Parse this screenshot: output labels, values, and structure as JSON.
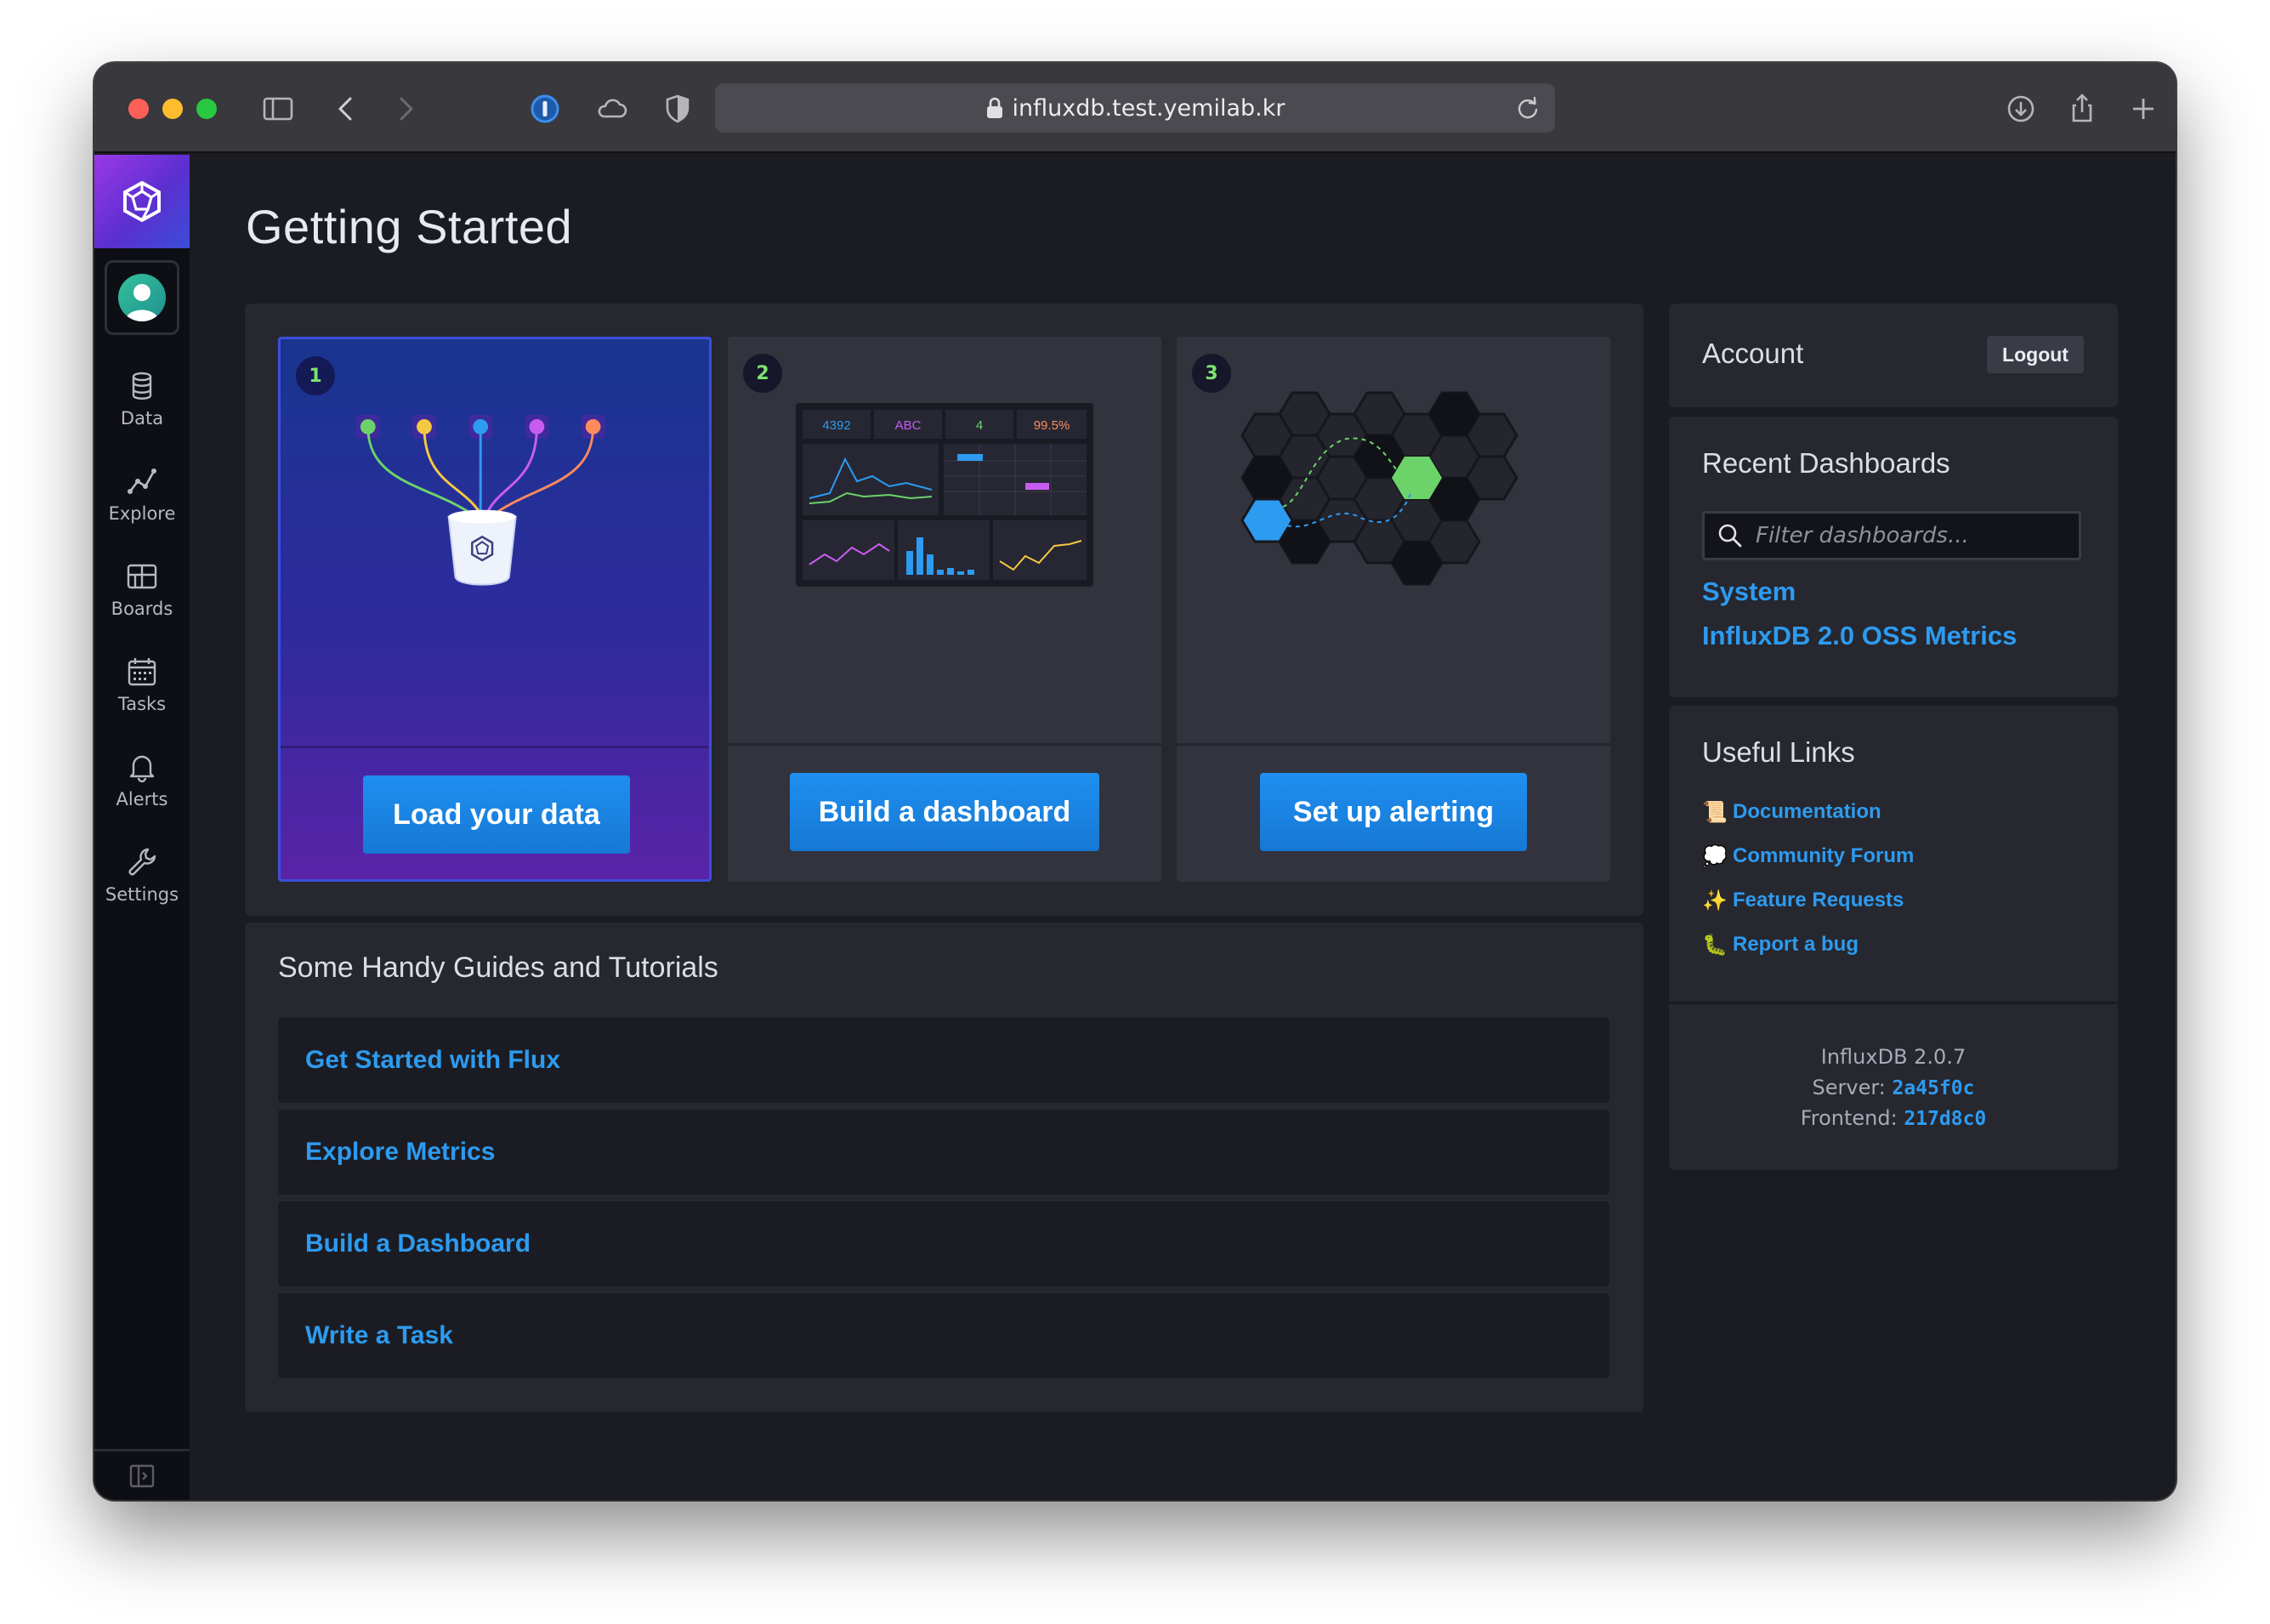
{
  "browser": {
    "url": "influxdb.test.yemilab.kr"
  },
  "sidebar": {
    "items": [
      {
        "label": "Data",
        "icon": "database-icon"
      },
      {
        "label": "Explore",
        "icon": "graph-icon"
      },
      {
        "label": "Boards",
        "icon": "grid-icon"
      },
      {
        "label": "Tasks",
        "icon": "calendar-icon"
      },
      {
        "label": "Alerts",
        "icon": "bell-icon"
      },
      {
        "label": "Settings",
        "icon": "wrench-icon"
      }
    ]
  },
  "main": {
    "title": "Getting Started",
    "steps": [
      {
        "number": "1",
        "button": "Load your data"
      },
      {
        "number": "2",
        "button": "Build a dashboard"
      },
      {
        "number": "3",
        "button": "Set up alerting"
      }
    ],
    "dashboard_illustration": {
      "stats": [
        "4392",
        "ABC",
        "4",
        "99.5%"
      ]
    },
    "guides": {
      "title": "Some Handy Guides and Tutorials",
      "items": [
        "Get Started with Flux",
        "Explore Metrics",
        "Build a Dashboard",
        "Write a Task"
      ]
    }
  },
  "account": {
    "title": "Account",
    "logout": "Logout"
  },
  "recent_dashboards": {
    "title": "Recent Dashboards",
    "filter_placeholder": "Filter dashboards...",
    "items": [
      "System",
      "InfluxDB 2.0 OSS Metrics"
    ]
  },
  "useful_links": {
    "title": "Useful Links",
    "items": [
      {
        "emoji": "📜",
        "label": "Documentation"
      },
      {
        "emoji": "💭",
        "label": "Community Forum"
      },
      {
        "emoji": "✨",
        "label": "Feature Requests"
      },
      {
        "emoji": "🐛",
        "label": "Report a bug"
      }
    ]
  },
  "version": {
    "product": "InfluxDB 2.0.7",
    "server_label": "Server:",
    "server": "2a45f0c",
    "frontend_label": "Frontend:",
    "frontend": "217d8c0"
  },
  "colors": {
    "accent": "#2d9bf0",
    "button": "#1f8ff0",
    "green": "#7ee36f",
    "background": "#1b1c22"
  }
}
